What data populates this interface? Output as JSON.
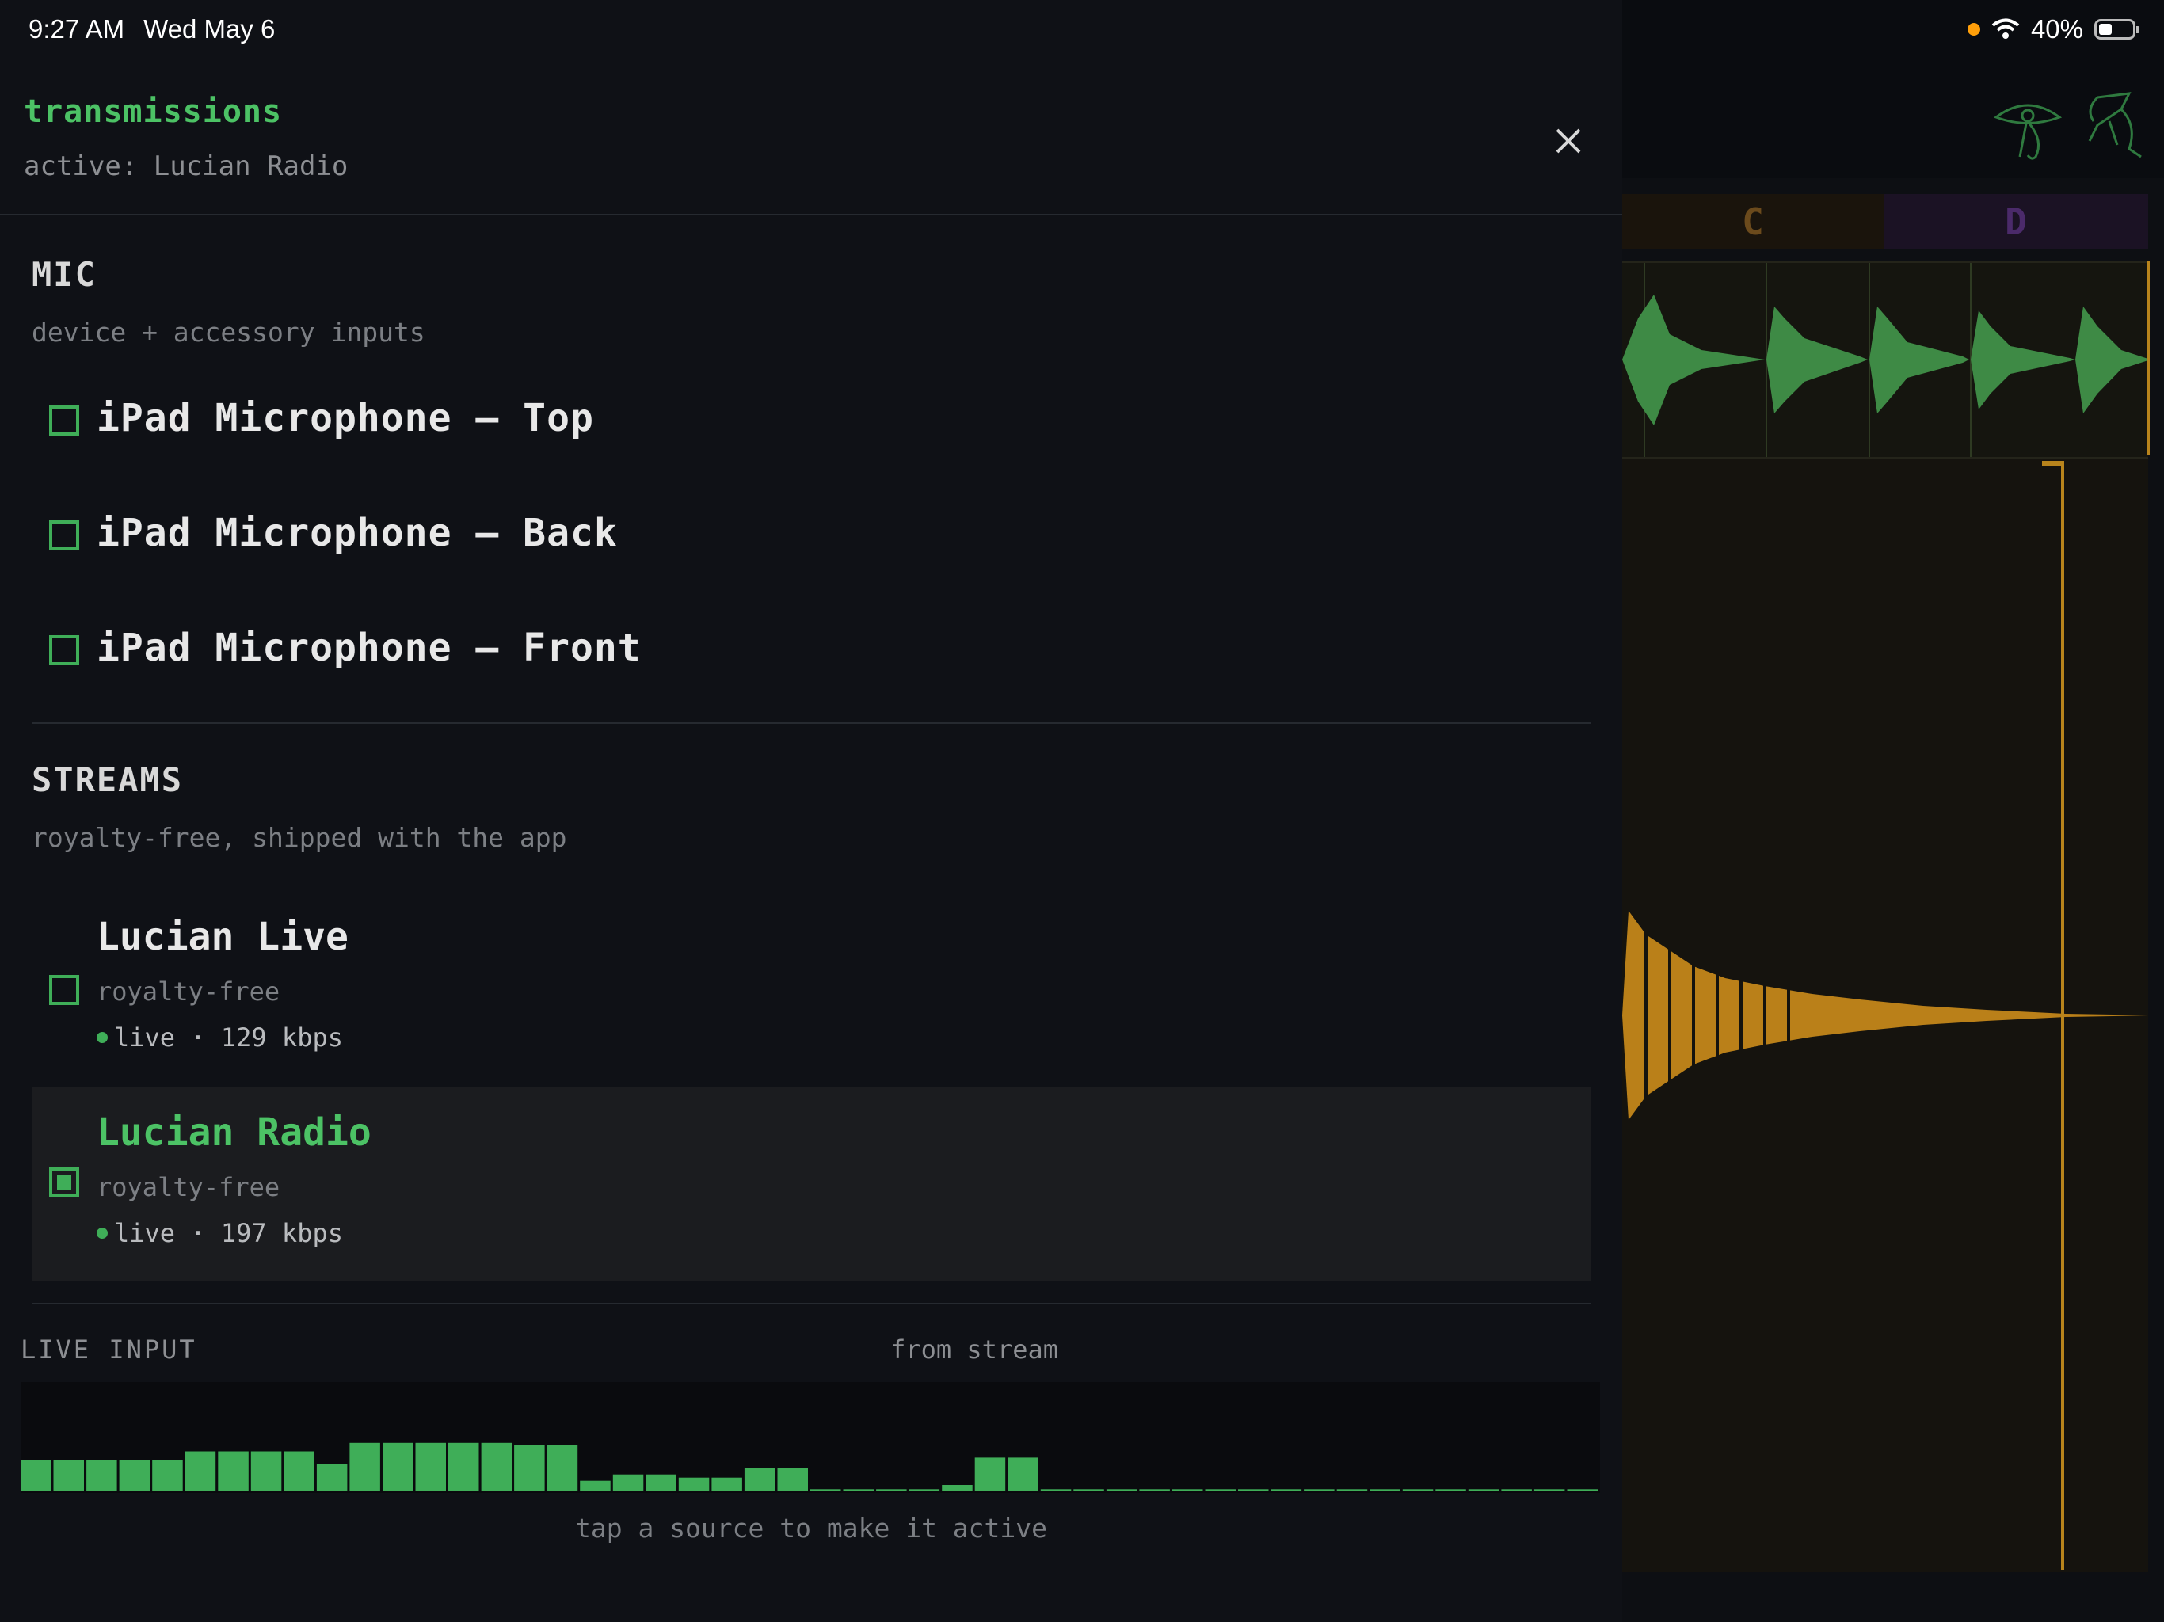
{
  "status": {
    "time": "9:27 AM",
    "date": "Wed May 6",
    "battery": "40%",
    "battery_level": 0.4
  },
  "panel": {
    "title": "transmissions",
    "subtitle": "active: Lucian Radio",
    "close_icon": "close-icon"
  },
  "mic": {
    "title": "MIC",
    "subtitle": "device + accessory inputs",
    "items": [
      {
        "label": "iPad Microphone — Top",
        "checked": false
      },
      {
        "label": "iPad Microphone — Back",
        "checked": false
      },
      {
        "label": "iPad Microphone — Front",
        "checked": false
      }
    ]
  },
  "streams": {
    "title": "STREAMS",
    "subtitle": "royalty-free, shipped with the app",
    "items": [
      {
        "name": "Lucian Live",
        "license": "royalty-free",
        "meta": "live · 129 kbps",
        "checked": false,
        "active": false
      },
      {
        "name": "Lucian Radio",
        "license": "royalty-free",
        "meta": "live · 197 kbps",
        "checked": true,
        "active": true
      }
    ]
  },
  "live_input": {
    "title": "LIVE INPUT",
    "source": "from stream",
    "levels": [
      0.3,
      0.3,
      0.3,
      0.3,
      0.3,
      0.38,
      0.38,
      0.38,
      0.38,
      0.26,
      0.46,
      0.46,
      0.46,
      0.46,
      0.46,
      0.44,
      0.44,
      0.1,
      0.16,
      0.16,
      0.13,
      0.13,
      0.22,
      0.22,
      0.02,
      0.02,
      0.02,
      0.02,
      0.06,
      0.32,
      0.32,
      0.02,
      0.02,
      0.02,
      0.02,
      0.02,
      0.02,
      0.02,
      0.02,
      0.02,
      0.02,
      0.02,
      0.02,
      0.02,
      0.02,
      0.02,
      0.02,
      0.02
    ],
    "hint": "tap a source to make it active"
  },
  "daw": {
    "lanes": [
      "C",
      "D"
    ],
    "colors": {
      "accent_green": "#4cc265",
      "track_orange": "#c98a1a",
      "lane_d": "#4b2a6a"
    },
    "icons": [
      "eye-icon",
      "figure-icon"
    ]
  }
}
